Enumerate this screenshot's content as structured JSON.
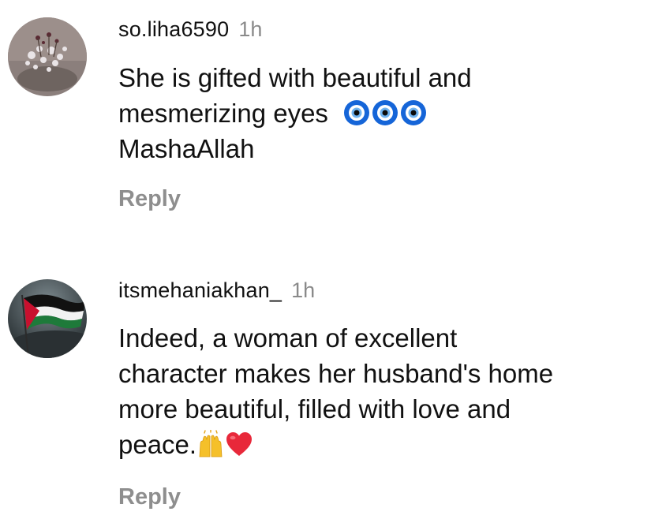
{
  "comments": [
    {
      "username": "so.liha6590",
      "time": "1h",
      "text_line1": "She is gifted with beautiful and",
      "text_line2": "mesmerizing eyes",
      "text_line3": "MashaAllah",
      "emojis": [
        "nazar-amulet-icon",
        "nazar-amulet-icon",
        "nazar-amulet-icon"
      ],
      "reply_label": "Reply"
    },
    {
      "username": "itsmehaniakhan_",
      "time": "1h",
      "text_line1": "Indeed, a woman of excellent",
      "text_line2": "character makes her husband's home",
      "text_line3": "more beautiful, filled with love and",
      "text_line4": "peace.",
      "emojis": [
        "raising-hands-icon",
        "red-heart-icon"
      ],
      "reply_label": "Reply"
    }
  ],
  "colors": {
    "text": "#111111",
    "muted": "#8e8e8e",
    "evil_eye_blue": "#1565d8",
    "heart": "#e8283a",
    "hands": "#f5c02a"
  }
}
